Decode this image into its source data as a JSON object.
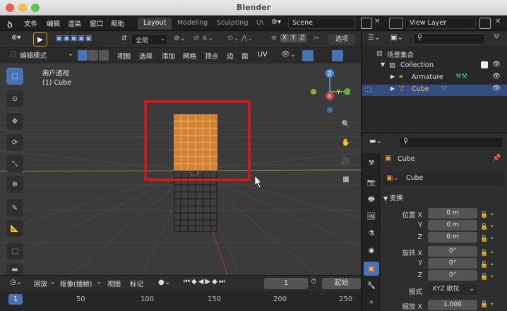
{
  "window": {
    "title": "Blender"
  },
  "menu": [
    "文件",
    "编辑",
    "渲染",
    "窗口",
    "帮助"
  ],
  "workspaces": [
    "Layout",
    "Modeling",
    "Sculpting",
    "U\\"
  ],
  "scene": "Scene",
  "view_layer": "View Layer",
  "toolbar": {
    "transform_space": "全局",
    "options": "选项"
  },
  "viewport_header": {
    "mode": "编辑模式",
    "menus": [
      "视图",
      "选择",
      "添加",
      "网格",
      "顶点",
      "边",
      "面",
      "UV"
    ]
  },
  "viewport": {
    "view_name": "用户透视",
    "object_name": "(1) Cube"
  },
  "gizmo": {
    "x": "X",
    "y": "Y",
    "z": "Z"
  },
  "axis_toggles": [
    "X",
    "Y",
    "Z"
  ],
  "timeline": {
    "menus": [
      "回放",
      "抠像(插帧)",
      "视图",
      "标记"
    ],
    "frame": "1",
    "start_label": "起始",
    "current_frame_marker": "1",
    "ruler": [
      "50",
      "100",
      "150",
      "200",
      "250"
    ]
  },
  "outliner": {
    "scene_collection": "场景集合",
    "collection": "Collection",
    "armature": "Armature",
    "cube": "Cube"
  },
  "properties": {
    "object_name": "Cube",
    "data_name": "Cube",
    "panel": "变换",
    "location_label": "位置 X",
    "rotation_label": "旋转 X",
    "y_label": "Y",
    "z_label": "Z",
    "location": [
      "0 m",
      "0 m",
      "0 m"
    ],
    "rotation": [
      "0°",
      "0°",
      "0°"
    ],
    "mode_label": "模式",
    "mode_value": "XYZ 欧拉",
    "scale_label": "缩放 X",
    "scale_x": "1.000"
  },
  "colors": {
    "accent": "#4772b3",
    "selection": "#f5a13b",
    "highlight_box": "#e01515"
  }
}
